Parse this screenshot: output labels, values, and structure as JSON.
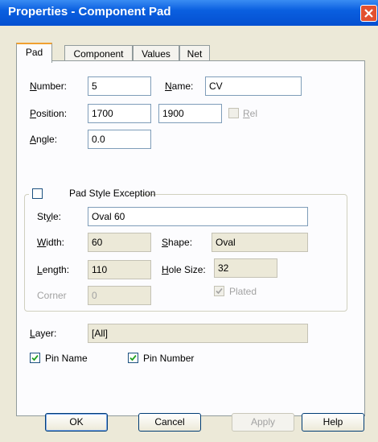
{
  "window": {
    "title": "Properties - Component Pad",
    "close_icon": "close-icon"
  },
  "tabs": [
    {
      "label": "Pad",
      "active": true
    },
    {
      "label": "Component"
    },
    {
      "label": "Values"
    },
    {
      "label": "Net"
    }
  ],
  "pad": {
    "number_label": "umber:",
    "number_mnemonic": "N",
    "number_value": "5",
    "name_label": "ame:",
    "name_mnemonic": "N",
    "name_value": "CV",
    "position_label": "osition:",
    "position_mnemonic": "P",
    "position_x": "1700",
    "position_y": "1900",
    "rel_label": "el",
    "rel_mnemonic": "R",
    "angle_label": "ngle:",
    "angle_mnemonic": "A",
    "angle_value": "0.0"
  },
  "style_group": {
    "title": "Pad Style Exception",
    "style_label_pre": "St",
    "style_label_mnemonic": "y",
    "style_label_post": "le:",
    "style_value": "Oval 60",
    "width_label_mnemonic": "W",
    "width_label": "idth:",
    "width_value": "60",
    "shape_label_mnemonic": "S",
    "shape_label": "hape:",
    "shape_value": "Oval",
    "length_label_mnemonic": "L",
    "length_label": "ength:",
    "length_value": "110",
    "holesize_label_mnemonic": "H",
    "holesize_label": "ole Size:",
    "holesize_value": "32",
    "corner_label": "Corner",
    "corner_value": "0",
    "plated_label": "Plated"
  },
  "layer": {
    "label_mnemonic": "L",
    "label": "ayer:",
    "value": "[All]"
  },
  "checks": {
    "pin_name": "Pin Name",
    "pin_number": "Pin Number"
  },
  "buttons": {
    "ok": "OK",
    "cancel": "Cancel",
    "apply": "Apply",
    "help": "Help"
  }
}
